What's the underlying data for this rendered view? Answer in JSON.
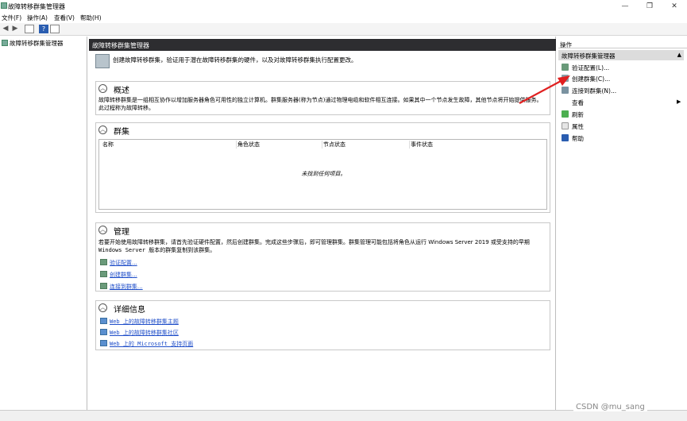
{
  "window": {
    "title": "故障转移群集管理器",
    "minimize": "—",
    "restore": "❐",
    "close": "✕"
  },
  "menu": [
    "文件(F)",
    "操作(A)",
    "查看(V)",
    "帮助(H)"
  ],
  "tree": {
    "root": "故障转移群集管理器"
  },
  "center": {
    "header": "故障转移群集管理器",
    "intro": "创建故障转移群集，验证用于潜在故障转移群集的硬件，以及对故障转移群集执行配置更改。",
    "overview": {
      "title": "概述",
      "desc": "故障转移群集是一组相互协作以增加服务器角色可用性的独立计算机。群集服务器(称为节点)通过物理电缆和软件相互连接。如果其中一个节点发生故障，其他节点将开始提供服务。此过程称为故障转移。"
    },
    "clusters": {
      "title": "群集",
      "columns": [
        "名称",
        "角色状态",
        "节点状态",
        "事件状态"
      ],
      "empty": "未找到任何项目。"
    },
    "management": {
      "title": "管理",
      "desc_1": "若要开始使用故障转移群集，请首先验证硬件配置，然后创建群集。完成这些步骤后，即可管理群集。群集管理可能包括将角色从运行 Windows Server 2019 或受支持的早期",
      "desc_2": "Windows Server 版本的群集复制到该群集。",
      "links": [
        "验证配置...",
        "创建群集...",
        "连接到群集..."
      ]
    },
    "details": {
      "title": "详细信息",
      "links": [
        "Web 上的故障转移群集主题",
        "Web 上的故障转移群集社区",
        "Web 上的 Microsoft 支持页面"
      ]
    }
  },
  "actions": {
    "header": "操作",
    "subheader": "故障转移群集管理器",
    "items": [
      "验证配置(L)...",
      "创建群集(C)...",
      "连接到群集(N)...",
      "查看",
      "刷新",
      "属性",
      "帮助"
    ]
  },
  "watermark": "CSDN @mu_sang",
  "colors": {
    "arrow": "#e02020",
    "header_bg": "#2d2d30",
    "link": "#1f4ec9"
  }
}
